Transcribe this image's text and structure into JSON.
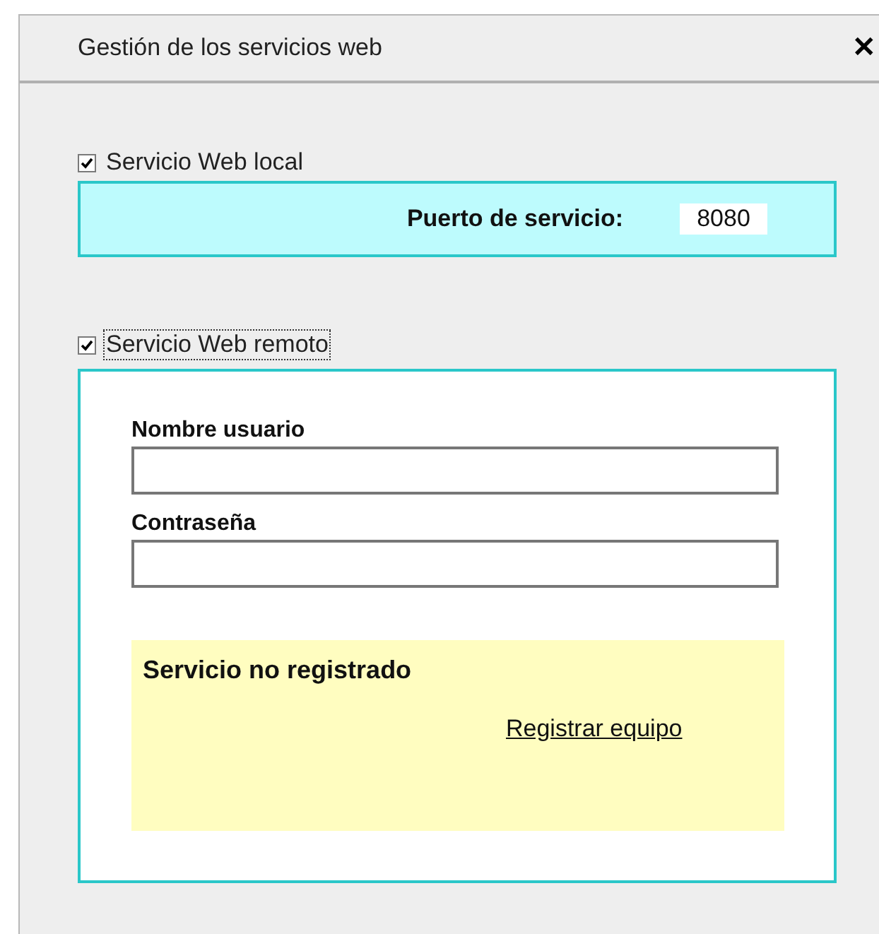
{
  "window": {
    "title": "Gestión de los servicios web",
    "close": "✕"
  },
  "local": {
    "checkbox": {
      "label": "Servicio Web local",
      "checked": true,
      "focused": false
    },
    "port_label": "Puerto de servicio:",
    "port_value": "8080"
  },
  "remote": {
    "checkbox": {
      "label": "Servicio Web remoto",
      "checked": true,
      "focused": true
    },
    "fields": [
      {
        "label": "Nombre usuario"
      },
      {
        "label": "Contraseña"
      }
    ],
    "status": {
      "message": "Servicio no registrado",
      "link": "Registrar equipo"
    }
  }
}
